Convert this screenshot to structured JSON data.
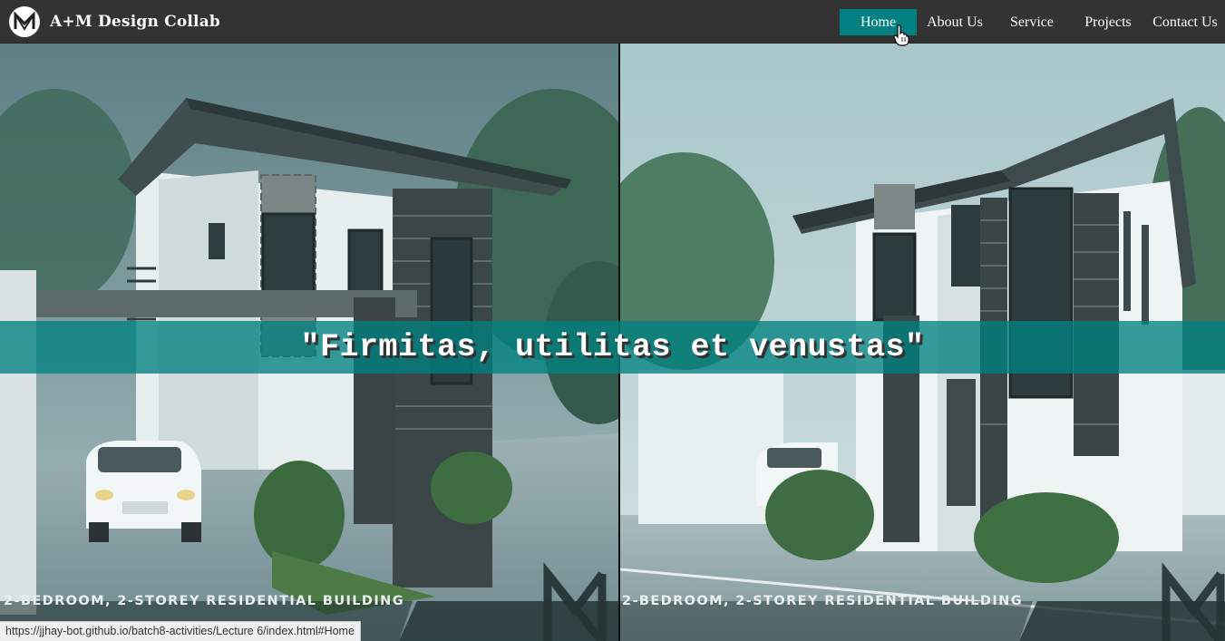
{
  "navbar": {
    "brand_name": "A+M Design Collab",
    "logo_icon": "am-monogram-icon",
    "links": [
      {
        "label": "Home",
        "active": true
      },
      {
        "label": "About Us",
        "active": false
      },
      {
        "label": "Service",
        "active": false
      },
      {
        "label": "Projects",
        "active": false
      },
      {
        "label": "Contact Us",
        "active": false
      }
    ]
  },
  "hero": {
    "tagline": "\"Firmitas, utilitas et venustas\"",
    "renders": [
      {
        "caption": "2-BEDROOM, 2-STOREY RESIDENTIAL BUILDING"
      },
      {
        "caption": "2-BEDROOM, 2-STOREY RESIDENTIAL BUILDING"
      }
    ]
  },
  "status_bar": {
    "url": "https://jjhay-bot.github.io/batch8-activities/Lecture 6/index.html#Home"
  },
  "colors": {
    "navbar_bg": "#333333",
    "accent_teal": "#008080",
    "nav_text": "#ffffff"
  }
}
